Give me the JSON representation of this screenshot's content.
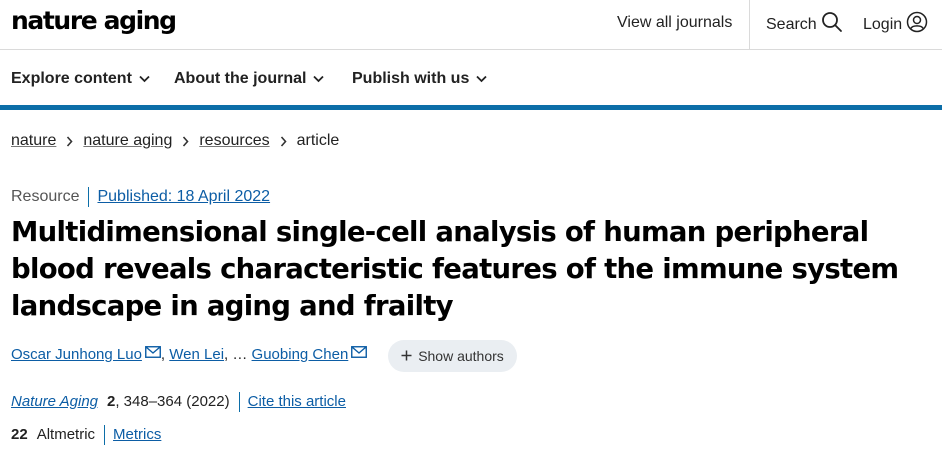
{
  "header": {
    "logo": "nature aging",
    "view_all": "View all journals",
    "search": "Search",
    "login": "Login"
  },
  "nav": {
    "items": [
      "Explore content",
      "About the journal",
      "Publish with us"
    ]
  },
  "breadcrumb": [
    "nature",
    "nature aging",
    "resources",
    "article"
  ],
  "article": {
    "type": "Resource",
    "published": "Published: 18 April 2022",
    "title": "Multidimensional single-cell analysis of human peripheral blood reveals characteristic features of the immune system landscape in aging and frailty",
    "authors": [
      "Oscar Junhong Luo",
      "Wen Lei",
      "Guobing Chen"
    ],
    "ellipsis": "…",
    "show_authors": "Show authors",
    "journal": "Nature Aging",
    "volume": "2",
    "pages_year": ", 348–364 (2022)",
    "cite": "Cite this article",
    "altmetric_count": "22",
    "altmetric_label": "Altmetric",
    "metrics": "Metrics"
  },
  "colors": {
    "accent": "#0c6ea8",
    "link": "#0c5da5"
  },
  "icons": [
    "search-icon",
    "user-icon",
    "chevron-down-icon",
    "chevron-right-icon",
    "mail-icon",
    "plus-icon"
  ]
}
